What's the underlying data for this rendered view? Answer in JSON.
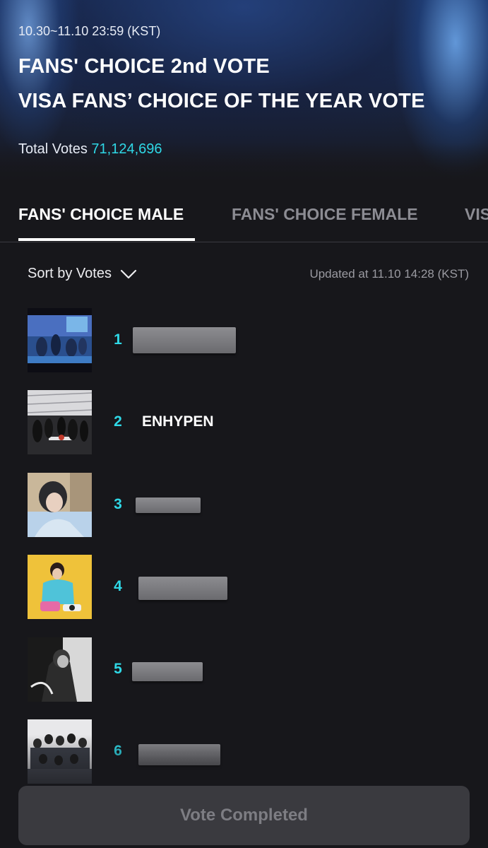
{
  "header": {
    "period": "10.30~11.10 23:59 (KST)",
    "title_line1": "FANS' CHOICE 2nd VOTE",
    "title_line2": "VISA FANS’ CHOICE OF THE YEAR VOTE",
    "total_label": "Total Votes",
    "total_value": "71,124,696"
  },
  "tabs": [
    {
      "label": "FANS' CHOICE MALE",
      "active": true
    },
    {
      "label": "FANS' CHOICE FEMALE",
      "active": false
    },
    {
      "label": "VIS",
      "active": false
    }
  ],
  "sort": {
    "label": "Sort by Votes",
    "icon": "chevron-down-icon"
  },
  "updated": "Updated at 11.10 14:28 (KST)",
  "ranking": [
    {
      "rank": "1",
      "name": "",
      "redacted": true
    },
    {
      "rank": "2",
      "name": "ENHYPEN",
      "redacted": false
    },
    {
      "rank": "3",
      "name": "",
      "redacted": true
    },
    {
      "rank": "4",
      "name": "",
      "redacted": true
    },
    {
      "rank": "5",
      "name": "",
      "redacted": true
    },
    {
      "rank": "6",
      "name": "",
      "redacted": true
    }
  ],
  "vote_button": {
    "label": "Vote Completed"
  },
  "colors": {
    "accent": "#2fd8e6",
    "background": "#17171b",
    "button_bg": "#3a3a3f",
    "button_text": "#7d7d83"
  }
}
